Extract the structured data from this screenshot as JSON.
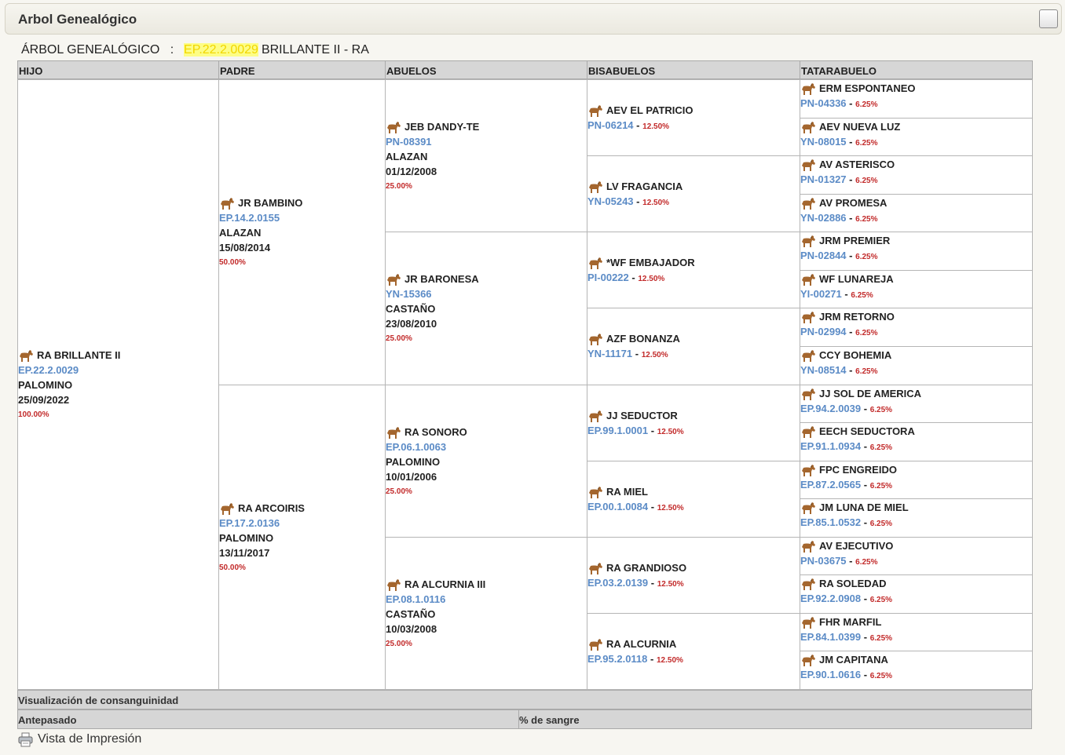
{
  "window": {
    "title": "Arbol Genealógico"
  },
  "caption": {
    "label": "ÁRBOL GENEALÓGICO",
    "colon": ":",
    "code": "EP.22.2.0029",
    "name": "BRILLANTE II - RA"
  },
  "columns": [
    "HIJO",
    "PADRE",
    "ABUELOS",
    "BISABUELOS",
    "TATARABUELO"
  ],
  "hijo": {
    "name": "RA BRILLANTE II",
    "reg": "EP.22.2.0029",
    "color": "PALOMINO",
    "date": "25/09/2022",
    "pct": "100.00%"
  },
  "padres": [
    {
      "name": "JR BAMBINO",
      "reg": "EP.14.2.0155",
      "color": "ALAZAN",
      "date": "15/08/2014",
      "pct": "50.00%"
    },
    {
      "name": "RA ARCOIRIS",
      "reg": "EP.17.2.0136",
      "color": "PALOMINO",
      "date": "13/11/2017",
      "pct": "50.00%"
    }
  ],
  "abuelos": [
    {
      "name": "JEB DANDY-TE",
      "reg": "PN-08391",
      "color": "ALAZAN",
      "date": "01/12/2008",
      "pct": "25.00%"
    },
    {
      "name": "JR BARONESA",
      "reg": "YN-15366",
      "color": "CASTAÑO",
      "date": "23/08/2010",
      "pct": "25.00%"
    },
    {
      "name": "RA SONORO",
      "reg": "EP.06.1.0063",
      "color": "PALOMINO",
      "date": "10/01/2006",
      "pct": "25.00%"
    },
    {
      "name": "RA ALCURNIA III",
      "reg": "EP.08.1.0116",
      "color": "CASTAÑO",
      "date": "10/03/2008",
      "pct": "25.00%"
    }
  ],
  "bisabuelos": [
    {
      "name": "AEV EL PATRICIO",
      "reg": "PN-06214",
      "pct": "12.50%"
    },
    {
      "name": "LV FRAGANCIA",
      "reg": "YN-05243",
      "pct": "12.50%"
    },
    {
      "name": "*WF EMBAJADOR",
      "reg": "PI-00222",
      "pct": "12.50%"
    },
    {
      "name": "AZF BONANZA",
      "reg": "YN-11171",
      "pct": "12.50%"
    },
    {
      "name": "JJ SEDUCTOR",
      "reg": "EP.99.1.0001",
      "pct": "12.50%"
    },
    {
      "name": "RA MIEL",
      "reg": "EP.00.1.0084",
      "pct": "12.50%"
    },
    {
      "name": "RA GRANDIOSO",
      "reg": "EP.03.2.0139",
      "pct": "12.50%"
    },
    {
      "name": "RA ALCURNIA",
      "reg": "EP.95.2.0118",
      "pct": "12.50%"
    }
  ],
  "tatarabuelos": [
    {
      "name": "ERM ESPONTANEO",
      "reg": "PN-04336",
      "pct": "6.25%"
    },
    {
      "name": "AEV NUEVA LUZ",
      "reg": "YN-08015",
      "pct": "6.25%"
    },
    {
      "name": "AV ASTERISCO",
      "reg": "PN-01327",
      "pct": "6.25%"
    },
    {
      "name": "AV PROMESA",
      "reg": "YN-02886",
      "pct": "6.25%"
    },
    {
      "name": "JRM PREMIER",
      "reg": "PN-02844",
      "pct": "6.25%"
    },
    {
      "name": "WF LUNAREJA",
      "reg": "YI-00271",
      "pct": "6.25%"
    },
    {
      "name": "JRM RETORNO",
      "reg": "PN-02994",
      "pct": "6.25%"
    },
    {
      "name": "CCY BOHEMIA",
      "reg": "YN-08514",
      "pct": "6.25%"
    },
    {
      "name": "JJ SOL DE AMERICA",
      "reg": "EP.94.2.0039",
      "pct": "6.25%"
    },
    {
      "name": "EECH SEDUCTORA",
      "reg": "EP.91.1.0934",
      "pct": "6.25%"
    },
    {
      "name": "FPC ENGREIDO",
      "reg": "EP.87.2.0565",
      "pct": "6.25%"
    },
    {
      "name": "JM LUNA DE MIEL",
      "reg": "EP.85.1.0532",
      "pct": "6.25%"
    },
    {
      "name": "AV EJECUTIVO",
      "reg": "PN-03675",
      "pct": "6.25%"
    },
    {
      "name": "RA SOLEDAD",
      "reg": "EP.92.2.0908",
      "pct": "6.25%"
    },
    {
      "name": "FHR MARFIL",
      "reg": "EP.84.1.0399",
      "pct": "6.25%"
    },
    {
      "name": "JM CAPITANA",
      "reg": "EP.90.1.0616",
      "pct": "6.25%"
    }
  ],
  "separator": "-",
  "consanguinity": {
    "title": "Visualización de consanguinidad",
    "col_ancestor": "Antepasado",
    "col_blood": "% de sangre"
  },
  "print": {
    "label": "Vista de Impresión"
  },
  "icons": {
    "horse": "horse-icon",
    "printer": "printer-icon",
    "window": "window-toggle-icon"
  }
}
